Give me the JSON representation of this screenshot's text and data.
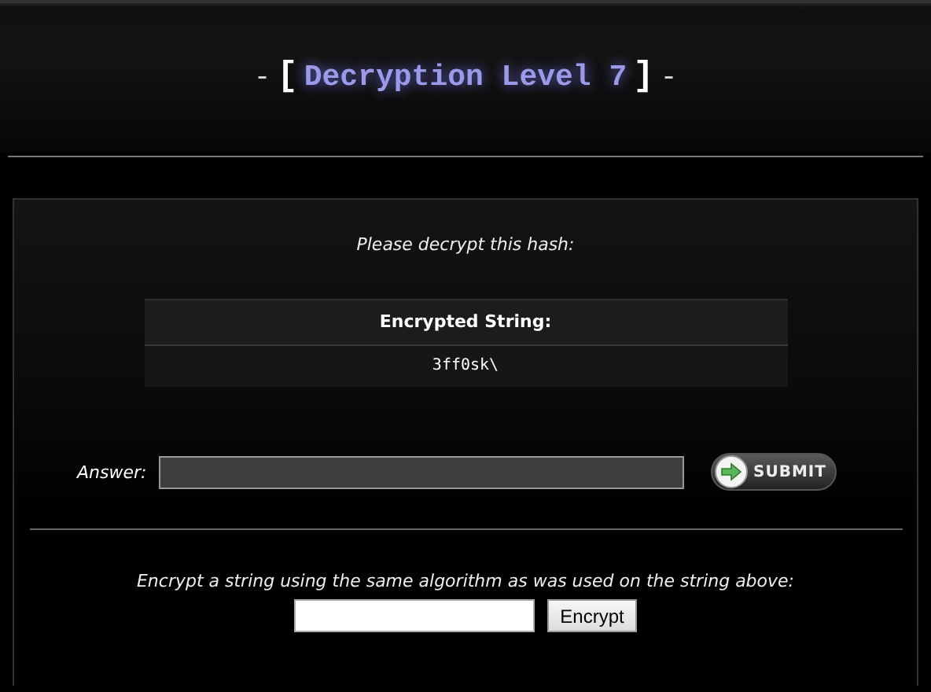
{
  "header": {
    "dash_left": "-",
    "bracket_left": "[",
    "title": "Decryption Level 7",
    "bracket_right": "]",
    "dash_right": "-"
  },
  "prompt": "Please decrypt this hash:",
  "table": {
    "heading": "Encrypted String:",
    "value": "3ff0sk\\"
  },
  "answer": {
    "label": "Answer:",
    "submit": "SUBMIT"
  },
  "encrypt": {
    "text": "Encrypt a string using the same algorithm as was used on the string above:",
    "button": "Encrypt"
  }
}
